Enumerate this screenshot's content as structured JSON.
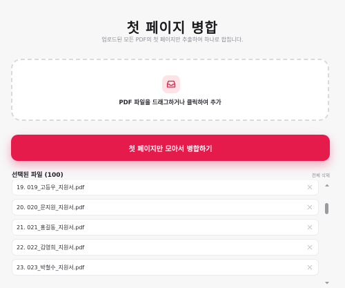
{
  "header": {
    "title": "첫 페이지 병합",
    "subtitle": "업로드된 모든 PDF의 첫 페이지만 추출하여 하나로 합칩니다."
  },
  "dropzone": {
    "icon": "tray-icon",
    "text": "PDF 파일을 드래그하거나 클릭하여 추가"
  },
  "merge_button": {
    "label": "첫 페이지만 모아서 병합하기"
  },
  "files": {
    "title": "선택된 파일 (100)",
    "clear_all": "전체 삭제",
    "items": [
      "19. 019_고등우_지원서.pdf",
      "20. 020_문지원_지원서.pdf",
      "21. 021_홍길동_지원서.pdf",
      "22. 022_김영희_지원서.pdf",
      "23. 023_박철수_지원서.pdf"
    ]
  },
  "colors": {
    "accent": "#e51b4c",
    "icon_bg": "#fde3e6"
  }
}
